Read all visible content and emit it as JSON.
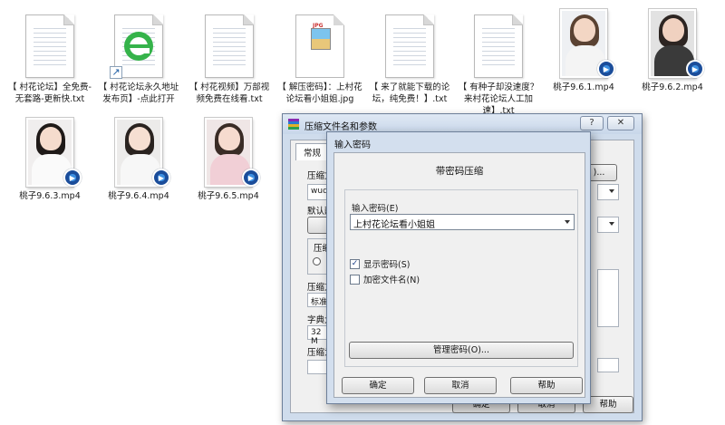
{
  "desktop": {
    "files": [
      {
        "label": "【 村花论坛】全免费-无套路-更新快.txt",
        "icon": "text-file-icon"
      },
      {
        "label": "【 村花论坛永久地址发布页】-点此打开",
        "icon": "ie-shortcut-icon"
      },
      {
        "label": "【 村花视频】万部视频免费在线看.txt",
        "icon": "text-file-icon"
      },
      {
        "label": "【 解压密码】：上村花论坛看小姐姐.jpg",
        "icon": "jpg-file-icon",
        "badge": "JPG"
      },
      {
        "label": "【 来了就能下载的论坛，纯免费！】.txt",
        "icon": "text-file-icon"
      },
      {
        "label": "【 有种子却没速度？来村花论坛人工加速】.txt",
        "icon": "text-file-icon"
      },
      {
        "label": "桃子9.6.1.mp4",
        "icon": "video-file-icon"
      },
      {
        "label": "桃子9.6.2.mp4",
        "icon": "video-file-icon"
      },
      {
        "label": "桃子9.6.3.mp4",
        "icon": "video-file-icon"
      },
      {
        "label": "桃子9.6.4.mp4",
        "icon": "video-file-icon"
      },
      {
        "label": "桃子9.6.5.mp4",
        "icon": "video-file-icon"
      }
    ]
  },
  "outer_dialog": {
    "title": "压缩文件名和参数",
    "help_button": "?",
    "close_button": "✕",
    "tab_general": "常规",
    "label_archive": "压缩文",
    "archive_name": "wuda",
    "label_default": "默认配",
    "label_format": "压缩",
    "label_method": "压缩方",
    "method_value": "标准",
    "label_dict": "字典大",
    "dict_value": "32 M",
    "label_split": "压缩为",
    "browse_button": ")...",
    "ok_button": "确定",
    "cancel_button": "取消",
    "help_btn_label": "帮助"
  },
  "password_dialog": {
    "title": "输入密码",
    "heading": "带密码压缩",
    "password_label": "输入密码(E)",
    "password_value": "上村花论坛看小姐姐",
    "show_password_label": "显示密码(S)",
    "show_password_checked": true,
    "encrypt_names_label": "加密文件名(N)",
    "encrypt_names_checked": false,
    "manage_button": "管理密码(O)...",
    "ok_button": "确定",
    "cancel_button": "取消",
    "help_button": "帮助"
  }
}
